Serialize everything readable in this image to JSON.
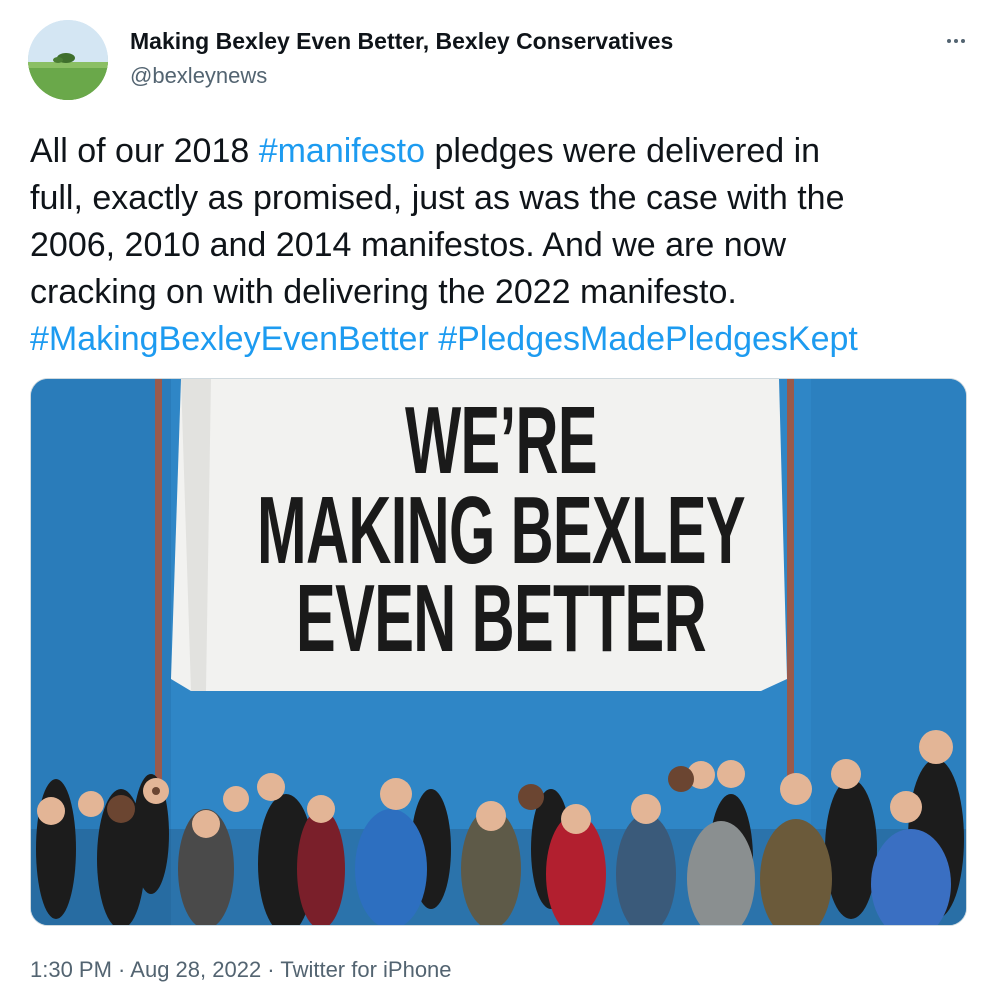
{
  "author": {
    "name": "Making Bexley Even Better, Bexley Conservatives",
    "handle": "@bexleynews"
  },
  "more_icon": "more-horizontal-icon",
  "tweet_text": {
    "line1_a": "All of our 2018 ",
    "line1_tag": "#manifesto",
    "line1_b": " pledges were delivered in",
    "line2": "full, exactly as promised, just as was the case with the",
    "line3": "2006, 2010 and 2014 manifestos. And we are now",
    "line4": "cracking on with delivering the 2022 manifesto.",
    "tag2": "#MakingBexleyEvenBetter",
    "tag3": "#PledgesMadePledgesKept"
  },
  "media": {
    "banner_line1": "WE’RE",
    "banner_line2": "MAKING BEXLEY",
    "banner_line3": "EVEN BETTER"
  },
  "footer": {
    "time": "1:30 PM",
    "sep1": " · ",
    "date": "Aug 28, 2022",
    "sep2": " · ",
    "source": "Twitter for iPhone"
  },
  "colors": {
    "link": "#1d9bf0",
    "secondary_text": "#536471",
    "primary_text": "#0f1419",
    "media_background": "#2f86c6"
  }
}
